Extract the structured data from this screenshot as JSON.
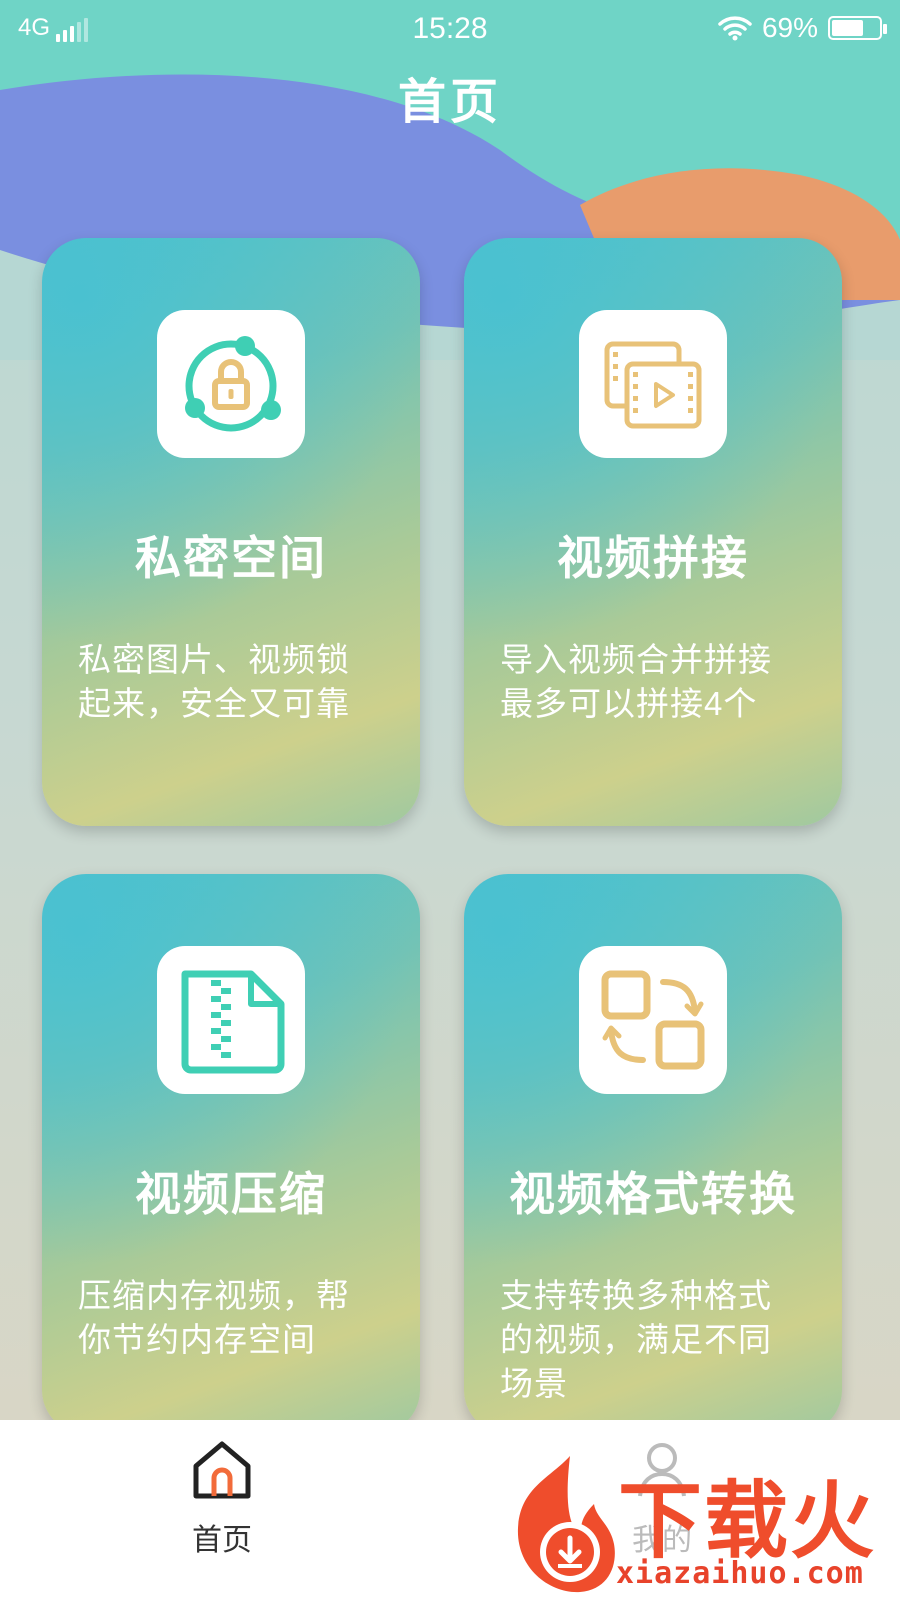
{
  "status_bar": {
    "network": "4G",
    "time": "15:28",
    "battery": "69%",
    "battery_level": 0.69
  },
  "header": {
    "title": "首页"
  },
  "cards": [
    {
      "title": "私密空间",
      "desc_line1": "私密图片、视频锁",
      "desc_line2": "起来，安全又可靠",
      "icon": "lock-icon"
    },
    {
      "title": "视频拼接",
      "desc_line1": "导入视频合并拼接",
      "desc_line2": "最多可以拼接4个",
      "icon": "video-splice-icon"
    },
    {
      "title": "视频压缩",
      "desc_line1": "压缩内存视频，帮",
      "desc_line2": "你节约内存空间",
      "icon": "zip-file-icon"
    },
    {
      "title": "视频格式转换",
      "desc_line1": "支持转换多种格式",
      "desc_line2": "的视频，满足不同",
      "desc_line3": "场景",
      "icon": "format-convert-icon"
    }
  ],
  "tab_bar": {
    "home": {
      "label": "首页",
      "icon": "home-icon"
    },
    "mine": {
      "label": "我的",
      "icon": "profile-icon"
    }
  },
  "watermark": {
    "brand": "下载火",
    "url": "xiazaihuo.com"
  },
  "colors": {
    "teal": "#6fd4c6",
    "blue_wave": "#7a8fe0",
    "orange_wave": "#e89c6c",
    "icon_teal": "#3fcfb4",
    "icon_gold": "#e8c278",
    "watermark_red": "#ef4d2c"
  }
}
